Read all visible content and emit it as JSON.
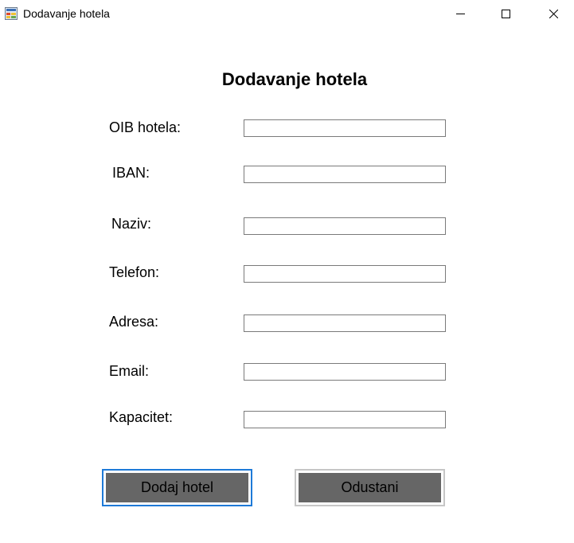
{
  "window": {
    "title": "Dodavanje hotela",
    "icon": "app-form-icon",
    "controls": [
      "minimize-icon",
      "maximize-icon",
      "close-icon"
    ]
  },
  "form": {
    "title": "Dodavanje hotela",
    "fields": [
      {
        "label": "OIB hotela:",
        "value": ""
      },
      {
        "label": "IBAN:",
        "value": ""
      },
      {
        "label": "Naziv:",
        "value": ""
      },
      {
        "label": "Telefon:",
        "value": ""
      },
      {
        "label": "Adresa:",
        "value": ""
      },
      {
        "label": "Email:",
        "value": ""
      },
      {
        "label": "Kapacitet:",
        "value": ""
      }
    ]
  },
  "buttons": {
    "add_label": "Dodaj hotel",
    "cancel_label": "Odustani"
  },
  "colors": {
    "button_face": "#666666",
    "focus_border": "#1e7ad8",
    "field_border": "#7a7a7a"
  }
}
